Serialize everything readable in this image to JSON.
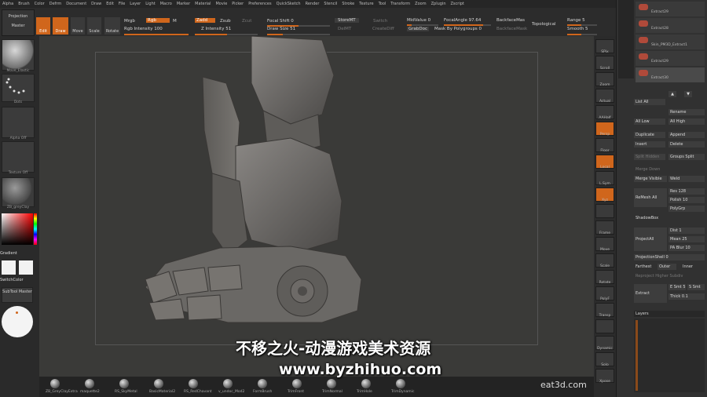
{
  "menu": [
    "Alpha",
    "Brush",
    "Color",
    "Defrm",
    "Document",
    "Draw",
    "Edit",
    "File",
    "Layer",
    "Light",
    "Macro",
    "Marker",
    "Material",
    "Movie",
    "Picker",
    "Preferences",
    "QuickSketch",
    "Render",
    "Stencil",
    "Stroke",
    "Texture",
    "Tool",
    "Transform",
    "Zoom",
    "Zplugin",
    "Zscript"
  ],
  "toolbar": {
    "projection_master": "Projection Master",
    "lightbox": "",
    "edit": "Edit",
    "draw": "Draw",
    "move": "Move",
    "scale": "Scale",
    "rotate": "Rotate",
    "mrgb": "Mrgb",
    "rgb": "Rgb",
    "m": "M",
    "rgb_intensity": "Rgb Intensity 100",
    "zadd": "Zadd",
    "zsub": "Zsub",
    "zcut": "Zcut",
    "z_intensity": "Z Intensity 51",
    "focal_shift": "Focal Shift 0",
    "draw_size": "Draw Size 51",
    "storemt": "StoreMT",
    "switch": "Switch",
    "dollst": "DelMT",
    "creatediff": "CreateDiff",
    "midvalue": "MidValue 0",
    "grabdoc": "GrabDoc",
    "focal_angle": "FocalAngle 97.64",
    "mask_by_polygroups": "Mask By Polygroups 0",
    "backface_mas": "BackfaceMas",
    "backfacemask": "BackfaceMask",
    "topological": "Topological",
    "range": "Range 5",
    "smooth": "Smooth 5"
  },
  "left": {
    "brush_label": "Move_Elastic",
    "stroke_label": "Dots",
    "alpha_label": "Alpha Off",
    "texture_label": "Texture Off",
    "material_label": "ZB_greyClay",
    "gradient": "Gradient",
    "switch_color": "SwitchColor",
    "subtool_master": "SubTool Master"
  },
  "right_strip": [
    "SPix",
    "Scroll",
    "Zoom",
    "Actual",
    "AAHalf",
    "Persp",
    "Floor",
    "Local",
    "L.Sym",
    "Xyz",
    "",
    "Frame",
    "Move",
    "Scale",
    "Rotate",
    "PolyF",
    "Transp",
    "",
    "Dynamic",
    "Solo",
    "Xpose"
  ],
  "right": {
    "subtools": [
      "Extract29",
      "Extract28",
      "Skin_PM3D_Extract1",
      "Extract29",
      "Extract30"
    ],
    "list_all": "List All",
    "rename": "Rename",
    "all_low": "All Low",
    "all_high": "All High",
    "duplicate": "Duplicate",
    "append": "Append",
    "insert": "Insert",
    "delete": "Delete",
    "split_hidden": "Split Hidden",
    "groups_split": "Groups Split",
    "merge_down": "Merge Down",
    "merge_visible": "Merge Visible",
    "weld": "Weld",
    "remesh_all": "ReMesh All",
    "res": "Res 128",
    "polish": "Polish 10",
    "polygrp": "PolyGrp",
    "shadowbox": "ShadowBox",
    "project_all": "ProjectAll",
    "dist": "Dist 1",
    "mean": "Mean 25",
    "pa_blur": "PA Blur 10",
    "projection_shell": "ProjectionShell 0",
    "farthest": "Farthest",
    "outer": "Outer",
    "inner": "Inner",
    "reproject": "Reproject Higher Subdiv",
    "extract": "Extract",
    "e_smt": "E Smt 5",
    "s_smt": "S Smt",
    "thick": "Thick 0.1",
    "layers": "Layers"
  },
  "materials": [
    "ZB_GreyClayExtra",
    "maquette2",
    "RS_SkyMetal",
    "BasicMaterial2",
    "RS_RedChavant",
    "v_undoc_Mod2",
    "FormBrush",
    "TrimFront",
    "TrimNormal",
    "TrimHole",
    "TrimDynamic"
  ],
  "watermark": {
    "line1": "不移之火-动漫游戏美术资源",
    "line2": "www.byzhihuo.com"
  },
  "brand": "eat3d.com",
  "colors": {
    "accent": "#d0661c",
    "model": "#6a6865",
    "bg": "#3a3a38"
  }
}
